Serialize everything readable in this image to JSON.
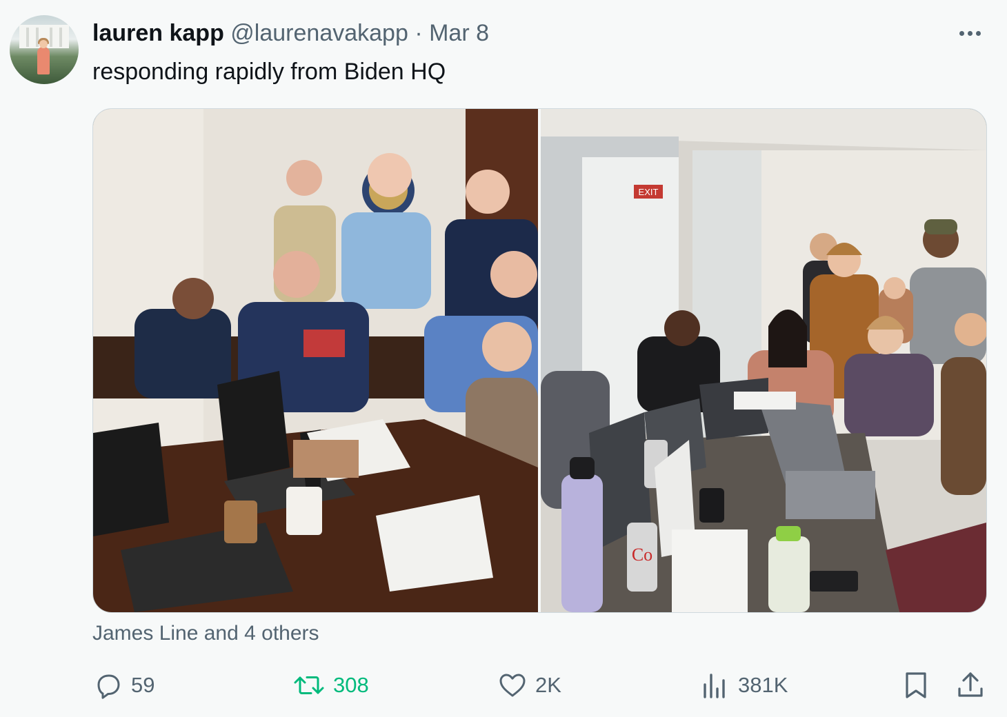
{
  "tweet": {
    "author_name": "lauren kapp",
    "handle": "@laurenavakapp",
    "separator": "·",
    "date": "Mar 8",
    "text": "responding rapidly from Biden HQ"
  },
  "media": {
    "left_photo_icon": "situation-room-photo",
    "right_photo_icon": "campaign-office-photo",
    "exit_sign": "EXIT"
  },
  "liked_by": "James Line and 4 others",
  "actions": {
    "replies": "59",
    "reposts": "308",
    "likes": "2K",
    "views": "381K"
  },
  "colors": {
    "text": "#0f1419",
    "secondary": "#536471",
    "repost_active": "#00ba7c",
    "background": "#f7f9f9"
  }
}
